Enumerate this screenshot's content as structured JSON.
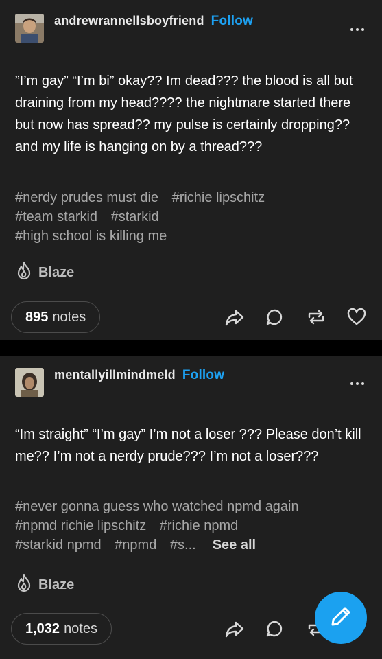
{
  "posts": [
    {
      "username": "andrewrannellsboyfriend",
      "follow_label": "Follow",
      "body": "”I’m gay” “I’m bi” okay?? Im dead??? the blood is all but draining from my head???? the nightmare started there but now has spread?? my pulse is certainly dropping?? and my life is hanging on by a thread???",
      "tags": [
        "#nerdy prudes must die",
        "#richie lipschitz",
        "#team starkid",
        "#starkid",
        "#high school is killing me"
      ],
      "blaze_label": "Blaze",
      "notes_count": "895",
      "notes_label": "notes"
    },
    {
      "username": "mentallyillmindmeld",
      "follow_label": "Follow",
      "body": "“Im straight” “I’m gay” I’m not a loser ??? Please don’t kill me?? I’m not a nerdy prude??? I’m not a loser???",
      "tags": [
        "#never gonna guess who watched npmd again",
        "#npmd richie lipschitz",
        "#richie npmd",
        "#starkid npmd",
        "#npmd",
        "#s..."
      ],
      "see_all_label": "See all",
      "blaze_label": "Blaze",
      "notes_count": "1,032",
      "notes_label": "notes"
    }
  ],
  "icons": [
    "more-icon",
    "flame-icon",
    "share-icon",
    "reply-icon",
    "reblog-icon",
    "heart-icon",
    "pencil-icon"
  ],
  "colors": {
    "background": "#000000",
    "card": "#1f1f1f",
    "accent": "#1da1f2",
    "fab": "#1ba1f0",
    "tag": "#a7a7a7"
  }
}
